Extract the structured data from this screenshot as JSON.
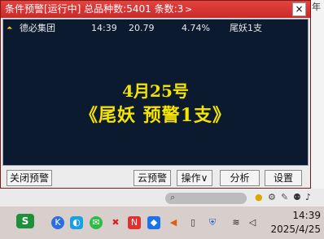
{
  "window": {
    "title": "条件预警[运行中] 总品种数:5401 条数:3",
    "expand_glyph": ">",
    "close_glyph": "×"
  },
  "alert_row": {
    "name": "德必集团",
    "time": "14:39",
    "price": "20.79",
    "change_pct": "4.74%",
    "tag": "尾妖1支"
  },
  "banner": {
    "line1": "4月25号",
    "line2": "《尾妖 预警1支》",
    "color": "#f5e400"
  },
  "buttons": {
    "close_alert": "关闭预警",
    "cloud_alert": "云预警",
    "operation": "操作∨",
    "analyze": "分析",
    "settings": "设置"
  },
  "edge_text": "年",
  "taskbar": {
    "start_label": "S",
    "time": "14:39",
    "date": "2025/4/25"
  },
  "colors": {
    "titlebar": "#d6312f",
    "list_bg": "#0b1a2e",
    "banner_text": "#f5e400"
  }
}
